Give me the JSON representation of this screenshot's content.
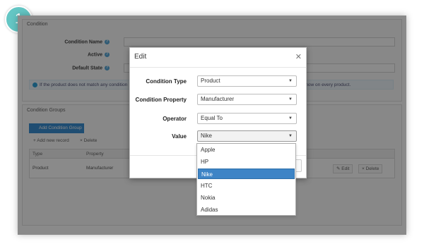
{
  "step": "1",
  "background": {
    "condition_panel_title": "Condition",
    "labels": [
      "Condition Name",
      "Active",
      "Default State"
    ],
    "info_text": "If the product does not match any condition",
    "info_text_right": "you want to show on every product.",
    "groups_title": "Condition Groups",
    "add_group_button": "Add Condition Group",
    "add_record": "Add new record",
    "delete": "Delete",
    "grid_headers": [
      "Type",
      "Property"
    ],
    "grid_row": [
      "Product",
      "Manufacturer"
    ],
    "row_edit": "Edit",
    "row_delete": "Delete"
  },
  "modal": {
    "title": "Edit",
    "close_icon": "close-icon",
    "fields": [
      {
        "label": "Condition Type",
        "value": "Product"
      },
      {
        "label": "Condition Property",
        "value": "Manufacturer"
      },
      {
        "label": "Operator",
        "value": "Equal To"
      },
      {
        "label": "Value",
        "value": "Nike"
      }
    ]
  },
  "dropdown": {
    "options": [
      "Apple",
      "HP",
      "Nike",
      "HTC",
      "Nokia",
      "Adidas"
    ],
    "selected": "Nike"
  },
  "colors": {
    "badge": "#64c6c4",
    "selected_option": "#3d84c6",
    "primary_button": "#3a8fd2"
  }
}
